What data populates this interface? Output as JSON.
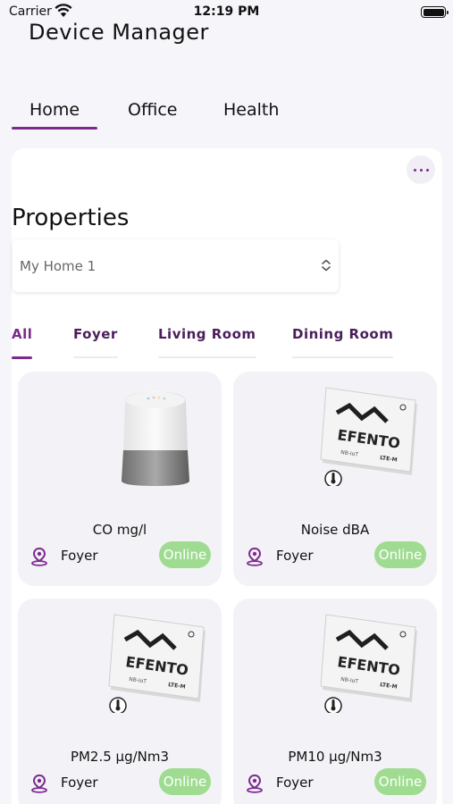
{
  "status_bar": {
    "carrier": "Carrier",
    "time": "12:19 PM"
  },
  "app": {
    "title": "Device Manager"
  },
  "top_tabs": [
    {
      "label": "Home",
      "active": true
    },
    {
      "label": "Office",
      "active": false
    },
    {
      "label": "Health",
      "active": false
    }
  ],
  "properties": {
    "title": "Properties",
    "selected": "My Home 1"
  },
  "room_tabs": [
    {
      "label": "All",
      "active": true
    },
    {
      "label": "Foyer",
      "active": false
    },
    {
      "label": "Living Room",
      "active": false
    },
    {
      "label": "Dining Room",
      "active": false
    }
  ],
  "devices": [
    {
      "name": "CO mg/l",
      "location": "Foyer",
      "status": "Online",
      "image": "smart-speaker",
      "logo_text": ""
    },
    {
      "name": "Noise dBA",
      "location": "Foyer",
      "status": "Online",
      "image": "efento-sensor",
      "logo_text": "EFENTO"
    },
    {
      "name": "PM2.5 µg/Nm3",
      "location": "Foyer",
      "status": "Online",
      "image": "efento-sensor",
      "logo_text": "EFENTO"
    },
    {
      "name": "PM10 µg/Nm3",
      "location": "Foyer",
      "status": "Online",
      "image": "efento-sensor",
      "logo_text": "EFENTO"
    }
  ],
  "colors": {
    "accent": "#7c2a90",
    "online_badge": "#9fdc91",
    "background": "#f6f5f9"
  },
  "icons": {
    "wifi": "wifi-icon",
    "battery": "battery-icon",
    "more": "more-icon",
    "chevron": "chevron-updown-icon",
    "location": "location-pin-icon"
  }
}
